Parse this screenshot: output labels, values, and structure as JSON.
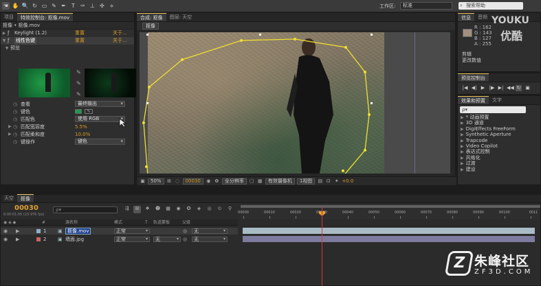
{
  "toolbar": {
    "tools": [
      "☚",
      "✋",
      "🔍",
      "↻",
      "▭",
      "✎",
      "✒",
      "T",
      "✑",
      "⊥",
      "✣",
      "⟡"
    ],
    "workspace_label": "工作区:",
    "workspace_value": "标准",
    "search_placeholder": "搜索帮助"
  },
  "project_panel": {
    "tabs": [
      "项目",
      "特效控制台: 抠像.mov"
    ],
    "breadcrumb": "抠像 • 抠像.mov",
    "effects": [
      {
        "name": "Keylight (1.2)",
        "reset": "重置",
        "about": "关于..."
      },
      {
        "name": "线性色键",
        "reset": "重置",
        "about": "关于..."
      }
    ],
    "preview_label": "预览",
    "props": {
      "view": {
        "name": "查看",
        "value": "最终输出"
      },
      "key_color": {
        "name": "键色"
      },
      "match_colors": {
        "name": "匹配色",
        "value": "使用 RGB"
      },
      "match_tolerance": {
        "name": "匹配宽容度",
        "value": "5.5%"
      },
      "match_softness": {
        "name": "匹配柔和度",
        "value": "10.0%"
      },
      "key_operation": {
        "name": "键操作",
        "value": "键色"
      }
    }
  },
  "comp_panel": {
    "tabs": [
      "合成: 抠像",
      "图层: 天空"
    ],
    "comp_chip": "抠像",
    "bottom": {
      "zoom": "50%",
      "timecode": "00030",
      "resolution": "全分辨率",
      "camera": "有效摄像机",
      "views": "1视图",
      "exposure": "+0.0"
    }
  },
  "info_panel": {
    "tabs": [
      "信息",
      "音频"
    ],
    "r": "R : 162",
    "g": "G : 143",
    "b": "B : 127",
    "a": "A : 255",
    "line1": "剪辑",
    "line2": "更改数值",
    "swatch_color": "#a28f7f"
  },
  "preview_panel": {
    "tabs": [
      "预览控制台"
    ],
    "buttons": [
      "|◀",
      "◀|",
      "▶",
      "|▶",
      "▶|",
      "◀◀",
      "↻",
      "▣"
    ]
  },
  "effects_panel": {
    "tabs": [
      "效果和预置",
      "文字"
    ],
    "search_placeholder": "ρ▾",
    "items": [
      "* 动画预置",
      "3D 通道",
      "DigiEffects FreeForm",
      "Synthetic Aperture",
      "Trapcode",
      "Video Copilot",
      "表达式控制",
      "风格化",
      "过渡",
      "建设"
    ]
  },
  "timeline": {
    "tabs": [
      "天空",
      "抠像"
    ],
    "timecode": "00030",
    "timecode_sub": "0:00:01:05 (23.976 fps)",
    "search_placeholder": "ρ▾",
    "headers": {
      "num": "#",
      "source": "源名称",
      "mode": "模式",
      "t": "T",
      "trkmat": "轨道蒙板",
      "parent": "父级"
    },
    "layers": [
      {
        "num": "1",
        "name": "抠像.mov",
        "mode": "正常",
        "trkmat": "",
        "parent": "无",
        "color": "#8fb0c8"
      },
      {
        "num": "2",
        "name": "墙面.jpg",
        "mode": "正常",
        "trkmat": "无",
        "parent": "无",
        "color": "#c86464"
      }
    ],
    "ruler_labels": [
      "00000",
      "00010",
      "00020",
      "00030",
      "00040",
      "00050",
      "00060",
      "00070",
      "00080",
      "00090",
      "00100",
      "0011"
    ],
    "track_colors": [
      "#a9bcc6",
      "#7e7c9e"
    ]
  },
  "logo": {
    "mark": "Z",
    "cn": "朱峰社区",
    "en": "ZF3D.COM"
  }
}
